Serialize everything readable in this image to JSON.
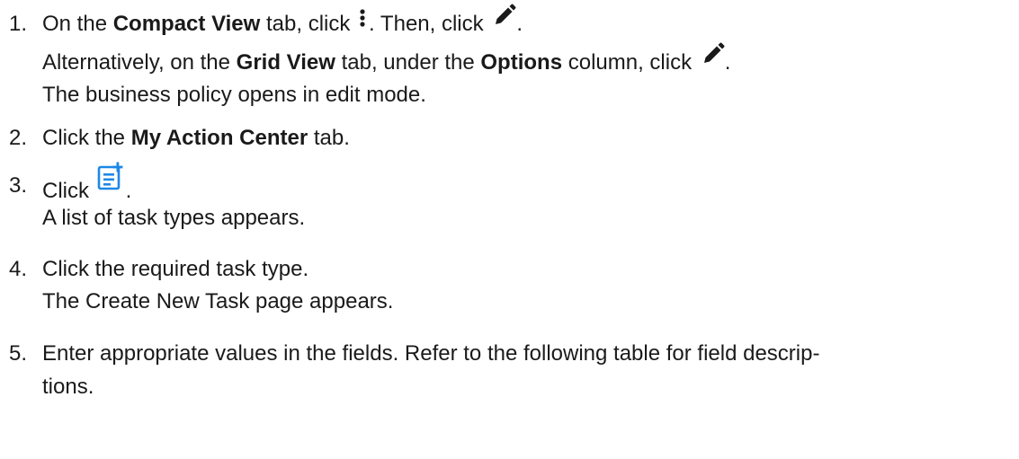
{
  "steps": [
    {
      "number": "1.",
      "lines": {
        "l1": {
          "a": "On the ",
          "b_bold": "Compact View",
          "c": " tab, click ",
          "d": ". Then, click ",
          "e": "."
        },
        "l2": {
          "a": "Alternatively, on the ",
          "b_bold": "Grid View",
          "c": " tab, under the ",
          "d_bold": "Options",
          "e": " column, click ",
          "f": "."
        },
        "l3": "The business policy opens in edit mode."
      }
    },
    {
      "number": "2.",
      "lines": {
        "l1": {
          "a": "Click the ",
          "b_bold": "My Action Center",
          "c": " tab."
        }
      }
    },
    {
      "number": "3.",
      "lines": {
        "l1": {
          "a": "Click ",
          "b": "."
        },
        "l2": "A list of task types appears."
      }
    },
    {
      "number": "4.",
      "lines": {
        "l1": "Click the required task type.",
        "l2": "The Create New Task page appears."
      }
    },
    {
      "number": "5.",
      "lines": {
        "l1": "Enter appropriate values in the fields. Refer to the following table for field descrip-",
        "l2": "tions."
      }
    }
  ],
  "icons": {
    "more": "vertical-ellipsis-icon",
    "edit": "pencil-icon",
    "add_task": "add-task-icon"
  },
  "colors": {
    "text": "#1a1a1a",
    "icon_blue": "#1e88e5"
  }
}
